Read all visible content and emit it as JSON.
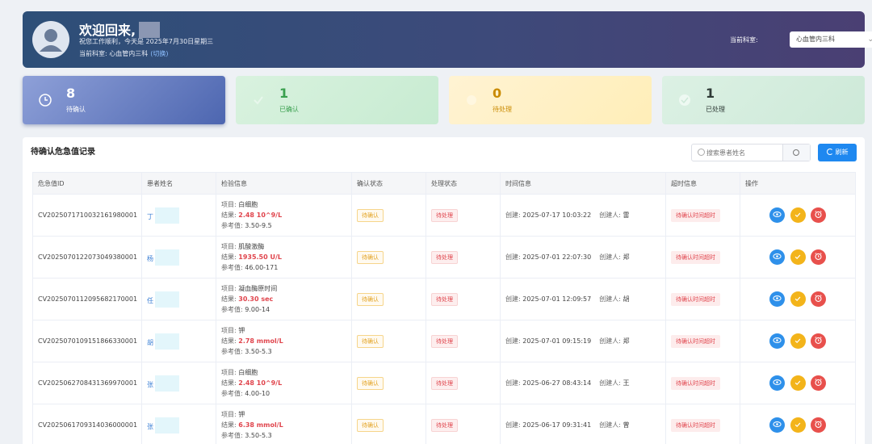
{
  "header": {
    "welcome": "欢迎回来,",
    "greeting": "祝您工作顺利，今天是 2025年7月30日星期三",
    "current_dept_prefix": "当前科室:",
    "current_dept": "心血管内三科",
    "switch_label": "(切换)",
    "dept_select_label": "当前科室:",
    "dept_select_value": "心血管内三科"
  },
  "stats": [
    {
      "value": "8",
      "label": "待确认",
      "icon": "clock-icon"
    },
    {
      "value": "1",
      "label": "已确认",
      "icon": "check-icon"
    },
    {
      "value": "0",
      "label": "待处理",
      "icon": "pending-icon"
    },
    {
      "value": "1",
      "label": "已处理",
      "icon": "done-icon"
    }
  ],
  "panel": {
    "title": "待确认危急值记录",
    "search_placeholder": "搜索患者姓名",
    "refresh_label": "刷新"
  },
  "table": {
    "columns": [
      "危急值ID",
      "患者姓名",
      "检验信息",
      "确认状态",
      "处理状态",
      "时间信息",
      "超时信息",
      "操作"
    ],
    "labels": {
      "item": "项目:",
      "result": "结果:",
      "ref": "参考值:",
      "created": "创建:",
      "creator": "创建人:"
    },
    "rows": [
      {
        "id": "CV2025071710032161980001",
        "name": "丁",
        "item": "白细胞",
        "result": "2.48 10^9/L",
        "ref": "3.50-9.5",
        "confirm": "待确认",
        "process": "待处理",
        "created": "2025-07-17 10:03:22",
        "creator": "雷",
        "timeout": "待确认时间超时"
      },
      {
        "id": "CV2025070122073049380001",
        "name": "杨",
        "item": "肌酸激酶",
        "result": "1935.50 U/L",
        "ref": "46.00-171",
        "confirm": "待确认",
        "process": "待处理",
        "created": "2025-07-01 22:07:30",
        "creator": "郑",
        "timeout": "待确认时间超时"
      },
      {
        "id": "CV2025070112095682170001",
        "name": "任",
        "item": "凝血酶原时间",
        "result": "30.30 sec",
        "ref": "9.00-14",
        "confirm": "待确认",
        "process": "待处理",
        "created": "2025-07-01 12:09:57",
        "creator": "胡",
        "timeout": "待确认时间超时"
      },
      {
        "id": "CV2025070109151866330001",
        "name": "胡",
        "item": "钾",
        "result": "2.78 mmol/L",
        "ref": "3.50-5.3",
        "confirm": "待确认",
        "process": "待处理",
        "created": "2025-07-01 09:15:19",
        "creator": "郑",
        "timeout": "待确认时间超时"
      },
      {
        "id": "CV2025062708431369970001",
        "name": "张",
        "item": "白细胞",
        "result": "2.48 10^9/L",
        "ref": "4.00-10",
        "confirm": "待确认",
        "process": "待处理",
        "created": "2025-06-27 08:43:14",
        "creator": "王",
        "timeout": "待确认时间超时"
      },
      {
        "id": "CV2025061709314036000001",
        "name": "张",
        "item": "钾",
        "result": "6.38 mmol/L",
        "ref": "3.50-5.3",
        "confirm": "待确认",
        "process": "待处理",
        "created": "2025-06-17 09:31:41",
        "creator": "曾",
        "timeout": "待确认时间超时"
      }
    ]
  },
  "colors": {
    "accent": "#1e88f0",
    "danger": "#e0454d",
    "warning": "#f3b41a",
    "view": "#2e90ea"
  }
}
